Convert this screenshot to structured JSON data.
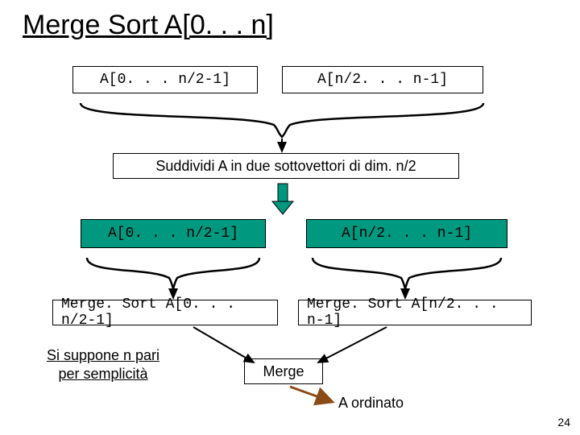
{
  "title": "Merge Sort A[0. . . n]",
  "top_left": "A[0. . . n/2-1]",
  "top_right": "A[n/2. . . n-1]",
  "step_split": "Suddividi A in due sottovettori di dim. n/2",
  "mid_left": "A[0. . . n/2-1]",
  "mid_right": "A[n/2. . . n-1]",
  "call_left": "Merge. Sort A[0. . . n/2-1]",
  "call_right": "Merge. Sort A[n/2. . . n-1]",
  "note": "Si suppone n pari\nper semplicità",
  "merge_label": "Merge",
  "result_label": "A ordinato",
  "page": "24"
}
